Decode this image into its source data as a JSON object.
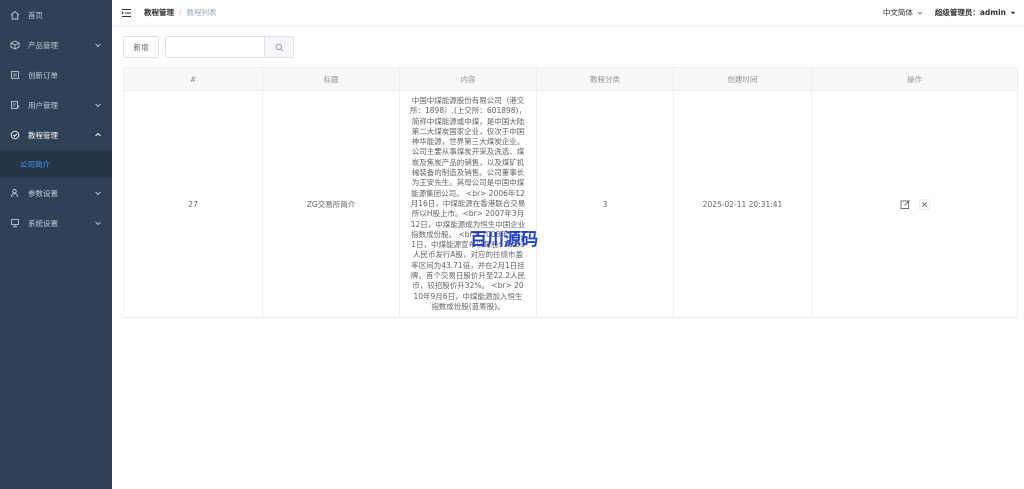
{
  "sidebar": {
    "items": [
      {
        "label": "首页",
        "icon": "home-icon"
      },
      {
        "label": "产品管理",
        "icon": "box-icon"
      },
      {
        "label": "创新订单",
        "icon": "order-icon"
      },
      {
        "label": "用户管理",
        "icon": "user-card-icon"
      },
      {
        "label": "教程管理",
        "icon": "check-circle-icon"
      },
      {
        "label": "参数设置",
        "icon": "user-setting-icon"
      },
      {
        "label": "系统设置",
        "icon": "monitor-icon"
      }
    ],
    "active_sub": "公司简介"
  },
  "navbar": {
    "breadcrumb": [
      "教程管理",
      "教程列表"
    ],
    "language": "中文简体",
    "user": "超级管理员：admin"
  },
  "toolbar": {
    "add_label": "新增",
    "search_value": "",
    "search_placeholder": ""
  },
  "table": {
    "headers": [
      "#",
      "标题",
      "内容",
      "教程分类",
      "创建时间",
      "操作"
    ],
    "rows": [
      {
        "id": "27",
        "title": "ZG交易所简介",
        "content": "中国中煤能源股份有限公司（港交所：1898）,(上交所：601898)，简称中煤能源或中煤，是中国大陆第二大煤炭国家企业，仅次于中国神华能源，世界第三大煤炭企业。公司主要从事煤炭开采及洗选、煤炭及焦炭产品的销售，以及煤矿机械装备的制造及销售。公司董事长为王安先生。其母公司是中国中煤能源集团公司。 <br> 2006年12月16日，中煤能源在香港联合交易所以H股上市。<br> 2007年3月12日，中煤能源成为恒生中国企业指数成份股。 <br> 2008年1月21日，中煤能源宣布以每股$16.83人民币发行A股，对应的往绩市盈率区间为43.71倍，并在2月1日挂牌。首个交易日股价升至22.2人民币，较招股价升32%。 <br> 2010年9月6日，中煤能源加入恒生指数成份股(蓝筹股)。",
        "category": "3",
        "created": "2025-02-11 20:31:41"
      }
    ]
  },
  "watermark": "百川源码",
  "colors": {
    "sidebar_bg": "#304156",
    "sidebar_text": "#bfcbd9",
    "active": "#409eff",
    "watermark": "#1f3fbf"
  }
}
